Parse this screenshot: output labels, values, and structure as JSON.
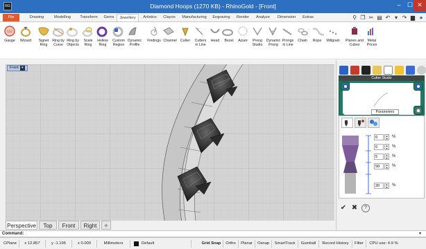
{
  "window": {
    "title": "Diamond Hoops (1270 KB) - RhinoGold - [Front]",
    "app_icon_text": "RG",
    "minimize": "–",
    "maximize": "☐",
    "close": "✕"
  },
  "ribbon_tabs": [
    "File",
    "Drawing",
    "Modelling",
    "Transform",
    "Gems",
    "Jewellery",
    "Artistics",
    "Clayoo",
    "Manufacturing",
    "Engraving",
    "Render",
    "Analyze",
    "Dimension",
    "Extras"
  ],
  "active_tab": "Jewellery",
  "ribbon_buttons": [
    {
      "label": "Gauge",
      "icon": "gauge-icon"
    },
    {
      "label": "Wizard",
      "icon": "wizard-icon"
    },
    {
      "label": "Signet\nRing",
      "icon": "signet-ring-icon"
    },
    {
      "label": "Ring by\nCurve",
      "icon": "ring-by-curve-icon"
    },
    {
      "label": "Ring by\nObjects",
      "icon": "ring-by-objects-icon"
    },
    {
      "label": "Scale\nRing",
      "icon": "scale-ring-icon"
    },
    {
      "label": "Hollow\nRing",
      "icon": "hollow-ring-icon"
    },
    {
      "label": "Custom\nRegion",
      "icon": "custom-region-icon"
    },
    {
      "label": "Dynamic\nProfile",
      "icon": "dynamic-profile-icon"
    },
    {
      "label": "Findings",
      "icon": "findings-icon"
    },
    {
      "label": "Channel",
      "icon": "channel-icon"
    },
    {
      "label": "Cutter",
      "icon": "cutter-icon"
    },
    {
      "label": "Cutters\nin Line",
      "icon": "cutters-in-line-icon"
    },
    {
      "label": "Head",
      "icon": "head-icon"
    },
    {
      "label": "Bezel",
      "icon": "bezel-icon"
    },
    {
      "label": "Azure",
      "icon": "azure-icon"
    },
    {
      "label": "Prong\nStudio",
      "icon": "prong-studio-icon"
    },
    {
      "label": "Dynamic\nProng",
      "icon": "dynamic-prong-icon"
    },
    {
      "label": "Prongs\nin Line",
      "icon": "prongs-in-line-icon"
    },
    {
      "label": "Chain",
      "icon": "chain-icon"
    },
    {
      "label": "Rope",
      "icon": "rope-icon"
    },
    {
      "label": "Millgrain",
      "icon": "millgrain-icon"
    },
    {
      "label": "Planes and\nCubes",
      "icon": "planes-and-cubes-icon"
    },
    {
      "label": "Metal\nPrices",
      "icon": "metal-prices-icon"
    }
  ],
  "viewport": {
    "label": "Front",
    "arrow": "▾",
    "tabs": [
      "Perspective",
      "Top",
      "Front",
      "Right"
    ],
    "active_tab": "Perspective",
    "add_tab": "✧"
  },
  "command": {
    "label": "Command:",
    "value": ""
  },
  "status_bar": {
    "cplane": "CPlane",
    "x": "x 12.857",
    "y": "y -1.195",
    "z": "z 0.000",
    "units": "Millimeters",
    "layer": "Default",
    "toggles": [
      "Grid Snap",
      "Ortho",
      "Planar",
      "Osnap",
      "SmartTrack",
      "Gumball",
      "Record History",
      "Filter"
    ],
    "cpu": "CPU use: 4.9 %"
  },
  "panel": {
    "cutter_studio_title": "Cutter Studio",
    "parameters_label": "Parameters",
    "params": [
      {
        "value": "0",
        "unit": "%"
      },
      {
        "value": "0",
        "unit": "%"
      },
      {
        "value": "5",
        "unit": "%"
      },
      {
        "value": "50",
        "unit": "%"
      },
      {
        "value": "20",
        "unit": "%"
      }
    ],
    "actions": [
      "✔",
      "✖",
      "?"
    ]
  },
  "colors": {
    "titlebar": "#2d6fc0",
    "file_tab": "#e45b2b",
    "viewport_bg": "#d3d3d3",
    "grid": "#bcbcbc",
    "ring": "#bdbdbd",
    "cutter": "#2d2d2d",
    "panel_teal": "#1f7a66"
  }
}
